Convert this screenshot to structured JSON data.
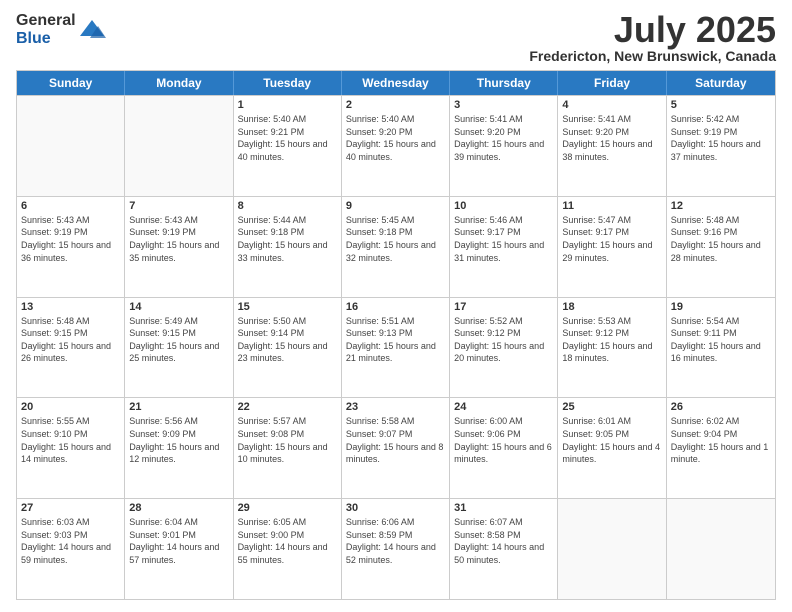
{
  "header": {
    "logo": {
      "general": "General",
      "blue": "Blue"
    },
    "title": "July 2025",
    "location": "Fredericton, New Brunswick, Canada"
  },
  "weekdays": [
    "Sunday",
    "Monday",
    "Tuesday",
    "Wednesday",
    "Thursday",
    "Friday",
    "Saturday"
  ],
  "weeks": [
    [
      {
        "day": "",
        "empty": true
      },
      {
        "day": "",
        "empty": true
      },
      {
        "day": "1",
        "sunrise": "Sunrise: 5:40 AM",
        "sunset": "Sunset: 9:21 PM",
        "daylight": "Daylight: 15 hours and 40 minutes."
      },
      {
        "day": "2",
        "sunrise": "Sunrise: 5:40 AM",
        "sunset": "Sunset: 9:20 PM",
        "daylight": "Daylight: 15 hours and 40 minutes."
      },
      {
        "day": "3",
        "sunrise": "Sunrise: 5:41 AM",
        "sunset": "Sunset: 9:20 PM",
        "daylight": "Daylight: 15 hours and 39 minutes."
      },
      {
        "day": "4",
        "sunrise": "Sunrise: 5:41 AM",
        "sunset": "Sunset: 9:20 PM",
        "daylight": "Daylight: 15 hours and 38 minutes."
      },
      {
        "day": "5",
        "sunrise": "Sunrise: 5:42 AM",
        "sunset": "Sunset: 9:19 PM",
        "daylight": "Daylight: 15 hours and 37 minutes."
      }
    ],
    [
      {
        "day": "6",
        "sunrise": "Sunrise: 5:43 AM",
        "sunset": "Sunset: 9:19 PM",
        "daylight": "Daylight: 15 hours and 36 minutes."
      },
      {
        "day": "7",
        "sunrise": "Sunrise: 5:43 AM",
        "sunset": "Sunset: 9:19 PM",
        "daylight": "Daylight: 15 hours and 35 minutes."
      },
      {
        "day": "8",
        "sunrise": "Sunrise: 5:44 AM",
        "sunset": "Sunset: 9:18 PM",
        "daylight": "Daylight: 15 hours and 33 minutes."
      },
      {
        "day": "9",
        "sunrise": "Sunrise: 5:45 AM",
        "sunset": "Sunset: 9:18 PM",
        "daylight": "Daylight: 15 hours and 32 minutes."
      },
      {
        "day": "10",
        "sunrise": "Sunrise: 5:46 AM",
        "sunset": "Sunset: 9:17 PM",
        "daylight": "Daylight: 15 hours and 31 minutes."
      },
      {
        "day": "11",
        "sunrise": "Sunrise: 5:47 AM",
        "sunset": "Sunset: 9:17 PM",
        "daylight": "Daylight: 15 hours and 29 minutes."
      },
      {
        "day": "12",
        "sunrise": "Sunrise: 5:48 AM",
        "sunset": "Sunset: 9:16 PM",
        "daylight": "Daylight: 15 hours and 28 minutes."
      }
    ],
    [
      {
        "day": "13",
        "sunrise": "Sunrise: 5:48 AM",
        "sunset": "Sunset: 9:15 PM",
        "daylight": "Daylight: 15 hours and 26 minutes."
      },
      {
        "day": "14",
        "sunrise": "Sunrise: 5:49 AM",
        "sunset": "Sunset: 9:15 PM",
        "daylight": "Daylight: 15 hours and 25 minutes."
      },
      {
        "day": "15",
        "sunrise": "Sunrise: 5:50 AM",
        "sunset": "Sunset: 9:14 PM",
        "daylight": "Daylight: 15 hours and 23 minutes."
      },
      {
        "day": "16",
        "sunrise": "Sunrise: 5:51 AM",
        "sunset": "Sunset: 9:13 PM",
        "daylight": "Daylight: 15 hours and 21 minutes."
      },
      {
        "day": "17",
        "sunrise": "Sunrise: 5:52 AM",
        "sunset": "Sunset: 9:12 PM",
        "daylight": "Daylight: 15 hours and 20 minutes."
      },
      {
        "day": "18",
        "sunrise": "Sunrise: 5:53 AM",
        "sunset": "Sunset: 9:12 PM",
        "daylight": "Daylight: 15 hours and 18 minutes."
      },
      {
        "day": "19",
        "sunrise": "Sunrise: 5:54 AM",
        "sunset": "Sunset: 9:11 PM",
        "daylight": "Daylight: 15 hours and 16 minutes."
      }
    ],
    [
      {
        "day": "20",
        "sunrise": "Sunrise: 5:55 AM",
        "sunset": "Sunset: 9:10 PM",
        "daylight": "Daylight: 15 hours and 14 minutes."
      },
      {
        "day": "21",
        "sunrise": "Sunrise: 5:56 AM",
        "sunset": "Sunset: 9:09 PM",
        "daylight": "Daylight: 15 hours and 12 minutes."
      },
      {
        "day": "22",
        "sunrise": "Sunrise: 5:57 AM",
        "sunset": "Sunset: 9:08 PM",
        "daylight": "Daylight: 15 hours and 10 minutes."
      },
      {
        "day": "23",
        "sunrise": "Sunrise: 5:58 AM",
        "sunset": "Sunset: 9:07 PM",
        "daylight": "Daylight: 15 hours and 8 minutes."
      },
      {
        "day": "24",
        "sunrise": "Sunrise: 6:00 AM",
        "sunset": "Sunset: 9:06 PM",
        "daylight": "Daylight: 15 hours and 6 minutes."
      },
      {
        "day": "25",
        "sunrise": "Sunrise: 6:01 AM",
        "sunset": "Sunset: 9:05 PM",
        "daylight": "Daylight: 15 hours and 4 minutes."
      },
      {
        "day": "26",
        "sunrise": "Sunrise: 6:02 AM",
        "sunset": "Sunset: 9:04 PM",
        "daylight": "Daylight: 15 hours and 1 minute."
      }
    ],
    [
      {
        "day": "27",
        "sunrise": "Sunrise: 6:03 AM",
        "sunset": "Sunset: 9:03 PM",
        "daylight": "Daylight: 14 hours and 59 minutes."
      },
      {
        "day": "28",
        "sunrise": "Sunrise: 6:04 AM",
        "sunset": "Sunset: 9:01 PM",
        "daylight": "Daylight: 14 hours and 57 minutes."
      },
      {
        "day": "29",
        "sunrise": "Sunrise: 6:05 AM",
        "sunset": "Sunset: 9:00 PM",
        "daylight": "Daylight: 14 hours and 55 minutes."
      },
      {
        "day": "30",
        "sunrise": "Sunrise: 6:06 AM",
        "sunset": "Sunset: 8:59 PM",
        "daylight": "Daylight: 14 hours and 52 minutes."
      },
      {
        "day": "31",
        "sunrise": "Sunrise: 6:07 AM",
        "sunset": "Sunset: 8:58 PM",
        "daylight": "Daylight: 14 hours and 50 minutes."
      },
      {
        "day": "",
        "empty": true
      },
      {
        "day": "",
        "empty": true
      }
    ]
  ]
}
